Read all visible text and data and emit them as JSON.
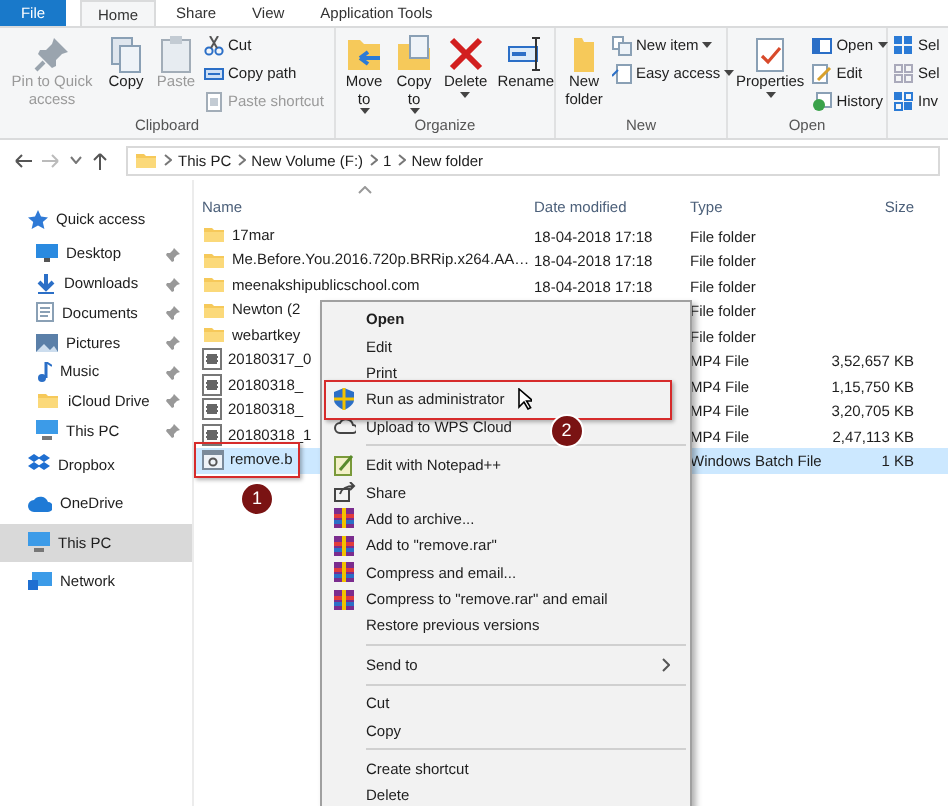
{
  "tabs": [
    {
      "label": "File",
      "kind": "file",
      "selected": false
    },
    {
      "label": "Home",
      "kind": "tab",
      "selected": true
    },
    {
      "label": "Share",
      "kind": "tab",
      "selected": false
    },
    {
      "label": "View",
      "kind": "tab",
      "selected": false
    },
    {
      "label": "Application Tools",
      "kind": "tab",
      "selected": false
    }
  ],
  "ribbon": {
    "groups": [
      {
        "label": "Clipboard",
        "buttons": [
          {
            "label": "Pin to Quick access",
            "kind": "large",
            "disabled": true,
            "dropdown": false
          },
          {
            "label": "Copy",
            "kind": "large",
            "disabled": false,
            "dropdown": false
          },
          {
            "label": "Paste",
            "kind": "large",
            "disabled": true,
            "dropdown": false
          },
          {
            "label": "Cut",
            "kind": "small",
            "disabled": false,
            "dropdown": false
          },
          {
            "label": "Copy path",
            "kind": "small",
            "disabled": false,
            "dropdown": false
          },
          {
            "label": "Paste shortcut",
            "kind": "small",
            "disabled": true,
            "dropdown": false
          }
        ]
      },
      {
        "label": "Organize",
        "buttons": [
          {
            "label": "Move to",
            "kind": "large",
            "disabled": false,
            "dropdown": true
          },
          {
            "label": "Copy to",
            "kind": "large",
            "disabled": false,
            "dropdown": true
          },
          {
            "label": "Delete",
            "kind": "large",
            "disabled": false,
            "dropdown": true
          },
          {
            "label": "Rename",
            "kind": "large",
            "disabled": false,
            "dropdown": false
          }
        ]
      },
      {
        "label": "New",
        "buttons": [
          {
            "label": "New folder",
            "kind": "large",
            "disabled": false,
            "dropdown": false
          },
          {
            "label": "New item",
            "kind": "small",
            "disabled": false,
            "dropdown": true
          },
          {
            "label": "Easy access",
            "kind": "small",
            "disabled": false,
            "dropdown": true
          }
        ]
      },
      {
        "label": "Open",
        "buttons": [
          {
            "label": "Properties",
            "kind": "large",
            "disabled": false,
            "dropdown": true
          },
          {
            "label": "Open",
            "kind": "small",
            "disabled": false,
            "dropdown": true
          },
          {
            "label": "Edit",
            "kind": "small",
            "disabled": false,
            "dropdown": false
          },
          {
            "label": "History",
            "kind": "small",
            "disabled": false,
            "dropdown": false
          }
        ]
      },
      {
        "buttons": [
          {
            "label": "Sel",
            "kind": "small",
            "disabled": false,
            "dropdown": false
          },
          {
            "label": "Sel",
            "kind": "small",
            "disabled": false,
            "dropdown": false
          },
          {
            "label": "Inv",
            "kind": "small",
            "disabled": false,
            "dropdown": false
          }
        ]
      }
    ]
  },
  "address": {
    "path": [
      "This PC",
      "New Volume (F:)",
      "1",
      "New folder"
    ]
  },
  "navigation": [
    {
      "label": "Quick access",
      "selected": false,
      "children": [
        {
          "label": "Desktop",
          "pinned": true,
          "selected": false
        },
        {
          "label": "Downloads",
          "pinned": true,
          "selected": false
        },
        {
          "label": "Documents",
          "pinned": true,
          "selected": false
        },
        {
          "label": "Pictures",
          "pinned": true,
          "selected": false
        },
        {
          "label": "Music",
          "pinned": true,
          "selected": false
        },
        {
          "label": "iCloud Drive",
          "pinned": true,
          "selected": false
        },
        {
          "label": "This PC",
          "pinned": true,
          "selected": false
        }
      ]
    },
    {
      "label": "Dropbox",
      "selected": false
    },
    {
      "label": "OneDrive",
      "selected": false
    },
    {
      "label": "This PC",
      "selected": true
    },
    {
      "label": "Network",
      "selected": false
    }
  ],
  "file_list": {
    "columns": [
      "Name",
      "Date modified",
      "Type",
      "Size"
    ],
    "files": [
      {
        "name": "17mar",
        "date": "18-04-2018 17:18",
        "type": "File folder",
        "kind": "folder",
        "selected": false
      },
      {
        "name": "Me.Before.You.2016.720p.BRRip.x264.AA…",
        "date": "18-04-2018 17:18",
        "type": "File folder",
        "kind": "folder",
        "selected": false
      },
      {
        "name": "meenakshipublicschool.com",
        "date": "18-04-2018 17:18",
        "type": "File folder",
        "kind": "folder",
        "selected": false
      },
      {
        "name": "Newton (2",
        "type": "File folder",
        "kind": "folder",
        "selected": false
      },
      {
        "name": "webartkey",
        "type": "File folder",
        "kind": "folder",
        "selected": false
      },
      {
        "name": "20180317_0",
        "type": "MP4 File",
        "size": "3,52,657 KB",
        "kind": "video",
        "selected": false
      },
      {
        "name": "20180318_",
        "type": "MP4 File",
        "size": "1,15,750 KB",
        "kind": "video",
        "selected": false
      },
      {
        "name": "20180318_",
        "type": "MP4 File",
        "size": "3,20,705 KB",
        "kind": "video",
        "selected": false
      },
      {
        "name": "20180318_1",
        "type": "MP4 File",
        "size": "2,47,113 KB",
        "kind": "video",
        "selected": false
      },
      {
        "name": "remove.b",
        "type": "Windows Batch File",
        "size": "1 KB",
        "kind": "batch",
        "selected": true,
        "annotation": "1"
      }
    ]
  },
  "context_menu": {
    "items": [
      {
        "kind": "item",
        "label": "Open",
        "default": true
      },
      {
        "kind": "item",
        "label": "Edit",
        "default": false
      },
      {
        "kind": "item",
        "label": "Print",
        "default": false
      },
      {
        "kind": "item",
        "label": "Run as administrator",
        "default": false,
        "annotation": "2"
      },
      {
        "kind": "item",
        "label": "Upload to WPS Cloud",
        "default": false
      },
      {
        "kind": "separator"
      },
      {
        "kind": "item",
        "label": "Edit with Notepad++",
        "default": false
      },
      {
        "kind": "item",
        "label": "Share",
        "default": false
      },
      {
        "kind": "item",
        "label": "Add to archive...",
        "default": false
      },
      {
        "kind": "item",
        "label": "Add to \"remove.rar\"",
        "default": false
      },
      {
        "kind": "item",
        "label": "Compress and email...",
        "default": false
      },
      {
        "kind": "item",
        "label": "Compress to \"remove.rar\" and email",
        "default": false
      },
      {
        "kind": "item",
        "label": "Restore previous versions",
        "default": false
      },
      {
        "kind": "separator"
      },
      {
        "kind": "item",
        "label": "Send to",
        "default": false,
        "submenu": true
      },
      {
        "kind": "separator"
      },
      {
        "kind": "item",
        "label": "Cut",
        "default": false
      },
      {
        "kind": "item",
        "label": "Copy",
        "default": false
      },
      {
        "kind": "separator"
      },
      {
        "kind": "item",
        "label": "Create shortcut",
        "default": false
      },
      {
        "kind": "item",
        "label": "Delete",
        "default": false
      }
    ]
  }
}
